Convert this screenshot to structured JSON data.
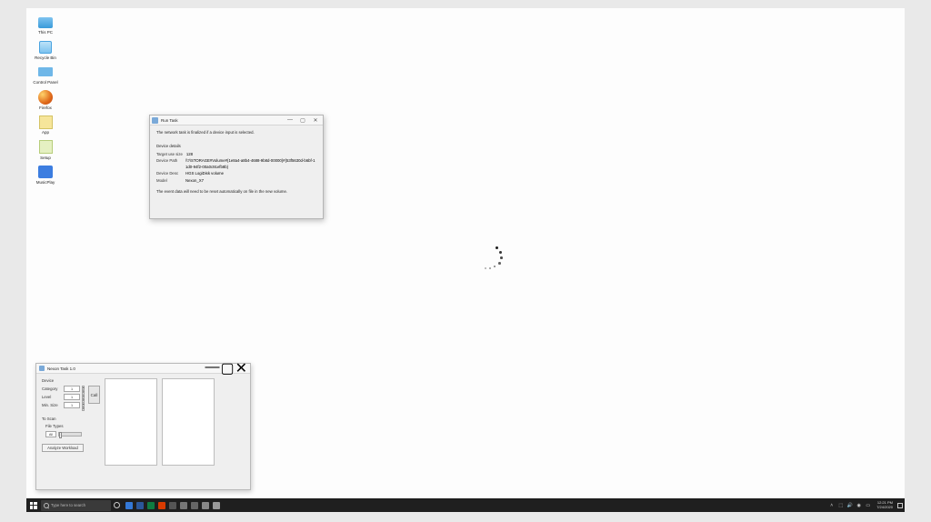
{
  "desktop": {
    "icons": [
      {
        "label": "This PC"
      },
      {
        "label": "Recycle Bin"
      },
      {
        "label": "Control Panel"
      },
      {
        "label": "Firefox"
      },
      {
        "label": "App"
      },
      {
        "label": "Setup"
      },
      {
        "label": "MusicPlay"
      }
    ]
  },
  "dialog": {
    "title": "Run Task",
    "intro": "The network task is finalized if a device input is selected.",
    "section": "Device details",
    "rows": {
      "target_size_k": "Target use size",
      "target_size_v": "128",
      "device_path_k": "Device Path",
      "device_path_v": "\\\\?\\STORAGE#Volume#{1e8a4-a8b4-4688-9b8d-00000}#{53f5630d-b6bf-11d0-94f2-00a0c91efb8b}",
      "device_desc_k": "Device Desc",
      "device_desc_v": "HGS LogiDisk volume",
      "model_k": "Model",
      "model_v": "Nexon_X7"
    },
    "footer": "The event data will need to be reset automatically on file in the new volume."
  },
  "win2": {
    "title": "Nexon Task 1.0",
    "section1": "Device",
    "fields": {
      "category_l": "Category",
      "level_l": "Level",
      "min_size_l": "Min. Size"
    },
    "values": {
      "category": "1",
      "level": "1",
      "min_size": "1"
    },
    "call_btn": "Call",
    "section2": "To Scan",
    "file_types_l": "File Types",
    "file_types_v": "All",
    "slider_val": "",
    "analyze_btn": "Analyze Workload"
  },
  "taskbar": {
    "search_placeholder": "Type here to search",
    "clock_time": "12:21 PM",
    "clock_date": "7/24/2020"
  }
}
